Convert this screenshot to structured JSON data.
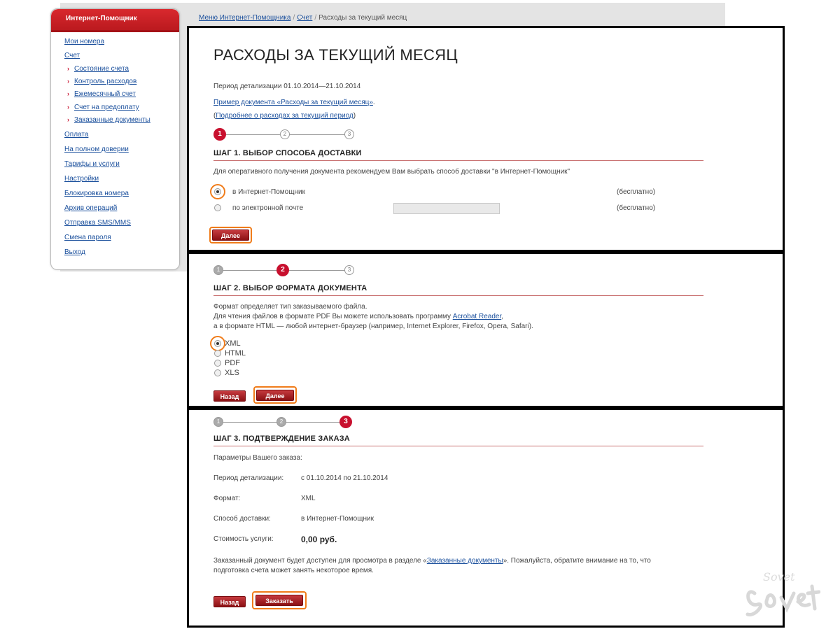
{
  "sidebar": {
    "title": "Интернет-Помощник",
    "items": [
      {
        "label": "Мои номера"
      },
      {
        "label": "Счет"
      },
      {
        "label": "Оплата"
      },
      {
        "label": "На полном доверии"
      },
      {
        "label": "Тарифы и услуги"
      },
      {
        "label": "Настройки"
      },
      {
        "label": "Блокировка номера"
      },
      {
        "label": "Архив операций"
      },
      {
        "label": "Отправка SMS/MMS"
      },
      {
        "label": "Смена пароля"
      },
      {
        "label": "Выход"
      }
    ],
    "sub_items": [
      {
        "label": "Состояние счета"
      },
      {
        "label": "Контроль расходов"
      },
      {
        "label": "Ежемесячный счет"
      },
      {
        "label": "Счет на предоплату"
      },
      {
        "label": "Заказанные документы"
      }
    ]
  },
  "breadcrumb": {
    "item1": "Меню Интернет-Помощника",
    "item2": "Счет",
    "current": "Расходы за текущий месяц",
    "separator": "/"
  },
  "page": {
    "title": "РАСХОДЫ ЗА ТЕКУЩИЙ МЕСЯЦ",
    "period": "Период детализации 01.10.2014—21.10.2014",
    "sample_link": "Пример документа «Расходы за текущий месяц»",
    "sample_tail": ".",
    "more_open": "(",
    "more_link": "Подробнее о расходах за текущий период",
    "more_close": ")"
  },
  "step1": {
    "title": "ШАГ 1. ВЫБОР СПОСОБА ДОСТАВКИ",
    "hint": "Для оперативного получения документа рекомендуем Вам выбрать способ доставки \"в Интернет-Помощник\"",
    "option1": "в Интернет-Помощник",
    "option1_price": "(бесплатно)",
    "option2": "по электронной почте",
    "option2_price": "(бесплатно)",
    "email_value": "",
    "next": "Далее"
  },
  "step2": {
    "title": "ШАГ 2. ВЫБОР ФОРМАТА ДОКУМЕНТА",
    "line1": "Формат определяет тип заказываемого файла.",
    "line2": "Для чтения файлов в формате PDF Вы можете использовать программу",
    "line2_link": "Acrobat Reader",
    "line2_tail": ",",
    "line3": "а в формате HTML — любой интернет-браузер (например, Internet Explorer, Firefox, Opera, Safari).",
    "formats": [
      "XML",
      "HTML",
      "PDF",
      "XLS"
    ],
    "back": "Назад",
    "next": "Далее"
  },
  "step3": {
    "title": "ШАГ 3. ПОДТВЕРЖДЕНИЕ ЗАКАЗА",
    "params": "Параметры Вашего заказа:",
    "period_label": "Период детализации:",
    "period_value": "с 01.10.2014 по 21.10.2014",
    "format_label": "Формат:",
    "format_value": "XML",
    "delivery_label": "Способ доставки:",
    "delivery_value": "в Интернет-Помощник",
    "cost_label": "Стоимость услуги:",
    "cost_value": "0,00 руб.",
    "note_pre": "Заказанный документ будет доступен для просмотра в разделе «",
    "note_link": "Заказанные документы",
    "note_post": "». Пожалуйста, обратите внимание на то, что",
    "note_line2": "подготовка счета может занять некоторое время.",
    "back": "Назад",
    "order": "Заказать"
  },
  "steps_numbers": [
    "1",
    "2",
    "3"
  ],
  "watermark": {
    "text": "Sovet"
  },
  "colors": {
    "accent_red": "#c8102e",
    "highlight_orange": "#f07c1a",
    "link_blue": "#1a4f9c"
  }
}
